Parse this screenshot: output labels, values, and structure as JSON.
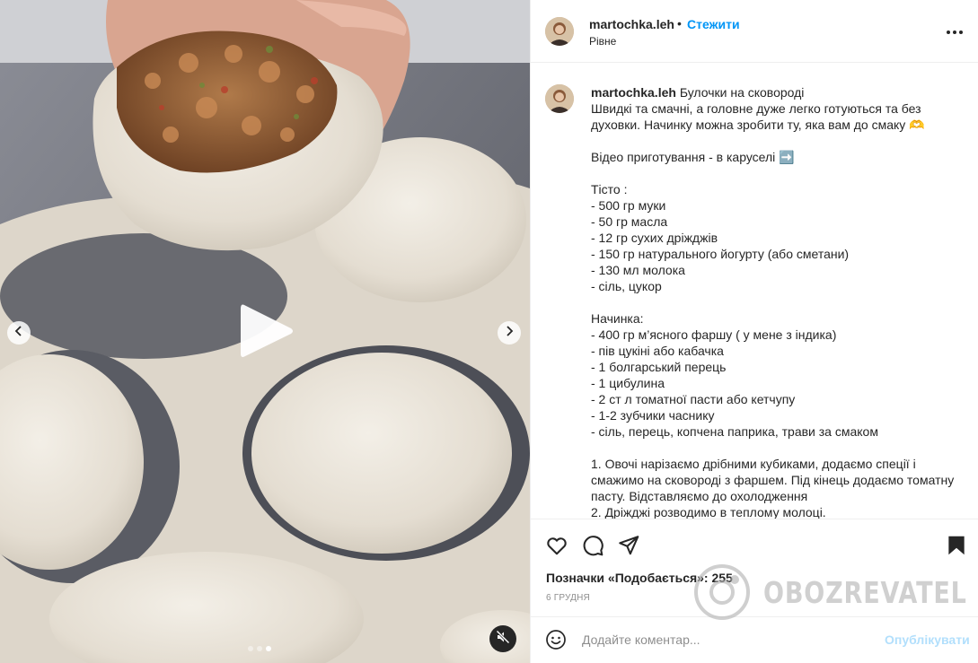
{
  "header": {
    "username": "martochka.leh",
    "separator": "•",
    "follow_label": "Стежити",
    "location": "Рівне",
    "more_icon": "more-horizontal-icon"
  },
  "caption": {
    "username": "martochka.leh",
    "text": "Булочки на сковороді\nШвидкі та смачні, а головне дуже легко готуються та без духовки. Начинку можна зробити ту, яка вам до смаку 🫶\n\nВідео приготування - в каруселі ➡️\n\nТісто :\n- 500 гр муки\n- 50 гр масла\n- 12 гр сухих дріжджів\n- 150 гр натурального йогурту (або сметани)\n- 130 мл молока\n- сіль, цукор\n\nНачинка:\n- 400 гр м’ясного фаршу ( у мене з індика)\n- пів цукіні або кабачка\n- 1 болгарський перець\n- 1 цибулина\n- 2 ст л томатної пасти або кетчупу\n- 1-2 зубчики часнику\n- сіль, перець, копчена паприка, трави за смаком\n\n1. Овочі нарізаємо дрібними кубиками, додаємо спеції і смажимо на сковороді з фаршем. Під кінець додаємо томатну пасту. Відставляємо до охолодження\n2. Дріжджі розводимо в теплому молоці."
  },
  "media": {
    "carousel_index": 3,
    "carousel_total": 3,
    "icons": [
      "play-icon",
      "chevron-left-icon",
      "chevron-right-icon",
      "muted-speaker-icon"
    ]
  },
  "actions": {
    "icons": [
      "heart-icon",
      "comment-icon",
      "send-icon",
      "bookmark-icon"
    ],
    "likes_label": "Позначки «Подобається»: 255",
    "date": "6 ГРУДНЯ"
  },
  "comment_box": {
    "placeholder": "Додайте коментар...",
    "publish_label": "Опублікувати",
    "emoji_icon": "smiley-icon"
  },
  "watermark": {
    "text": "OBOZREVATEL"
  },
  "colors": {
    "link_blue": "#0095f6",
    "publish_disabled": "#b2dffc",
    "text": "#262626",
    "muted": "#8e8e8e",
    "border": "#efefef"
  }
}
